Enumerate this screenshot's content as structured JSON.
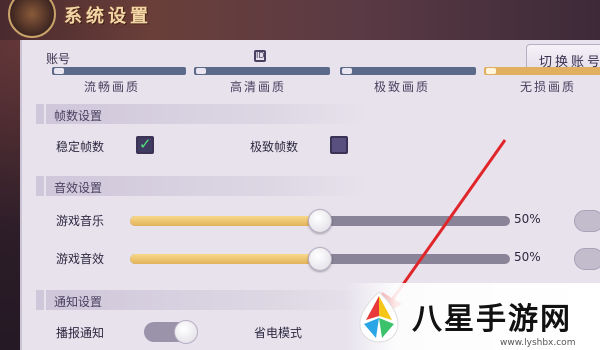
{
  "title": "系统设置",
  "account": {
    "label": "账号",
    "switch_label": "切换账号"
  },
  "quality_options": [
    "流畅画质",
    "高清画质",
    "极致画质",
    "无损画质"
  ],
  "sections": {
    "framerate": {
      "title": "帧数设置",
      "stable_label": "稳定帧数",
      "stable_checked": true,
      "extreme_label": "极致帧数",
      "extreme_checked": false
    },
    "sound": {
      "title": "音效设置",
      "music_label": "游戏音乐",
      "music_value": "50%",
      "music_level": 0.5,
      "sfx_label": "游戏音效",
      "sfx_value": "50%",
      "sfx_level": 0.5
    },
    "notify": {
      "title": "通知设置",
      "broadcast_label": "播报通知",
      "power_save_label": "省电模式"
    }
  },
  "watermark": {
    "text": "八星手游网",
    "url": "www.lyshbx.com"
  },
  "colors": {
    "panel": "#e7e2ec",
    "slider_fill": "#e2b25a",
    "checkmark": "#54e07a",
    "arrow": "#e0262b"
  }
}
